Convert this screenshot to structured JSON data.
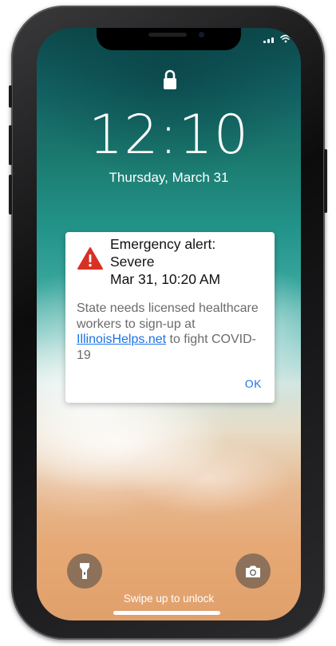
{
  "lock_screen": {
    "time": "12:10",
    "date": "Thursday, March 31"
  },
  "alert": {
    "title_line1": "Emergency alert:",
    "title_line2": "Severe",
    "title_line3": "Mar 31, 10:20 AM",
    "body_before_link": "State needs licensed healthcare workers to sign-up at ",
    "link_text": "IllinoisHelps.net",
    "body_after_link": " to fight COVID-19",
    "ok_label": "OK",
    "icon": "warning-triangle-icon",
    "icon_color": "#d93025",
    "link_color": "#1a73e8"
  },
  "bottom": {
    "swipe_text": "Swipe up to unlock",
    "left_icon": "flashlight-icon",
    "right_icon": "camera-icon"
  },
  "status_bar": {
    "icons": [
      "signal-icon",
      "wifi-icon"
    ]
  }
}
